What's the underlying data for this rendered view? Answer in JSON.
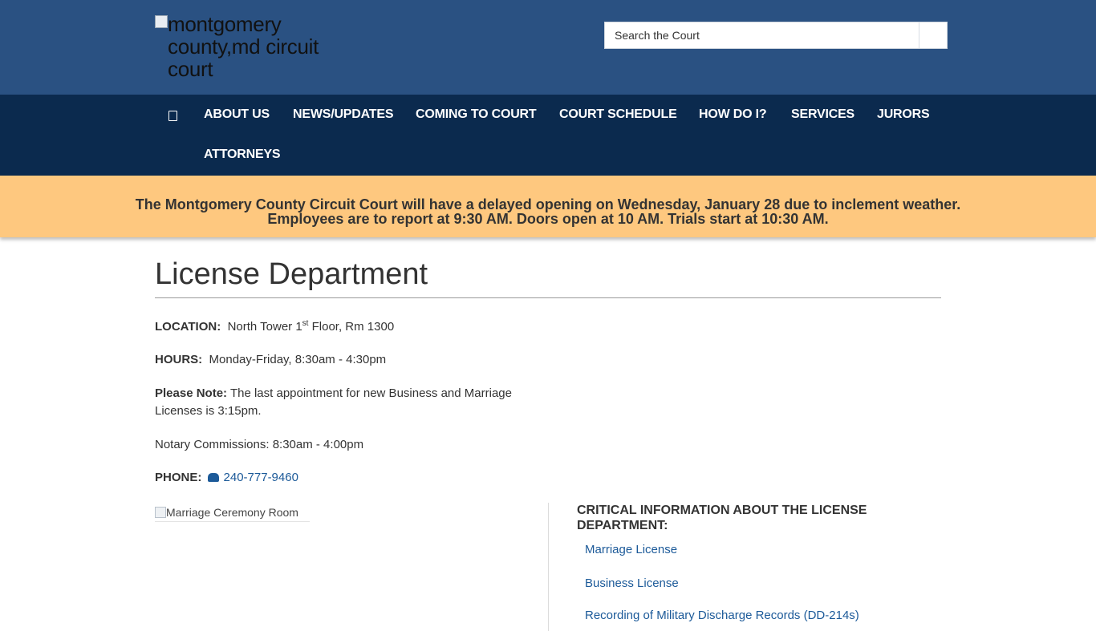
{
  "header": {
    "logo_alt": "montgomery county,md circuit court",
    "search": {
      "placeholder": "Search the Court"
    }
  },
  "nav": {
    "home_icon": "home-icon",
    "items": [
      "ABOUT US",
      "NEWS/UPDATES",
      "COMING TO COURT",
      "COURT SCHEDULE",
      "HOW DO I?",
      "SERVICES",
      "JURORS",
      "ATTORNEYS"
    ]
  },
  "alert": {
    "line1": "The Montgomery County Circuit Court will have a delayed opening on Wednesday, January 28 due to inclement weather.",
    "line2": "Employees are to report at 9:30 AM. Doors open at 10 AM. Trials start at 10:30 AM.",
    "background": "#fec87f"
  },
  "page": {
    "title": "License Department",
    "location_label": "LOCATION:",
    "location_value_pre": "North Tower 1",
    "location_value_sup": "st",
    "location_value_post": " Floor, Rm 1300",
    "hours_label": "HOURS:",
    "hours_value": "Monday-Friday, 8:30am - 4:30pm",
    "note_label": "Please Note:",
    "note_value": "The last appointment for new Business and Marriage Licenses is 3:15pm.",
    "notary": "Notary Commissions: 8:30am - 4:00pm",
    "phone_label": "PHONE:",
    "phone_icon": "phone-icon",
    "phone_value": "240-777-9460",
    "image_alt": "Marriage Ceremony Room",
    "critical_heading": "CRITICAL INFORMATION ABOUT THE LICENSE DEPARTMENT:",
    "links": [
      "Marriage License",
      "Business License",
      "Recording of Military Discharge Records (DD-214s)"
    ]
  },
  "colors": {
    "header_bg": "#2a5182",
    "nav_bg": "#0b2a4e",
    "link": "#1c5a99",
    "text": "#333333"
  }
}
